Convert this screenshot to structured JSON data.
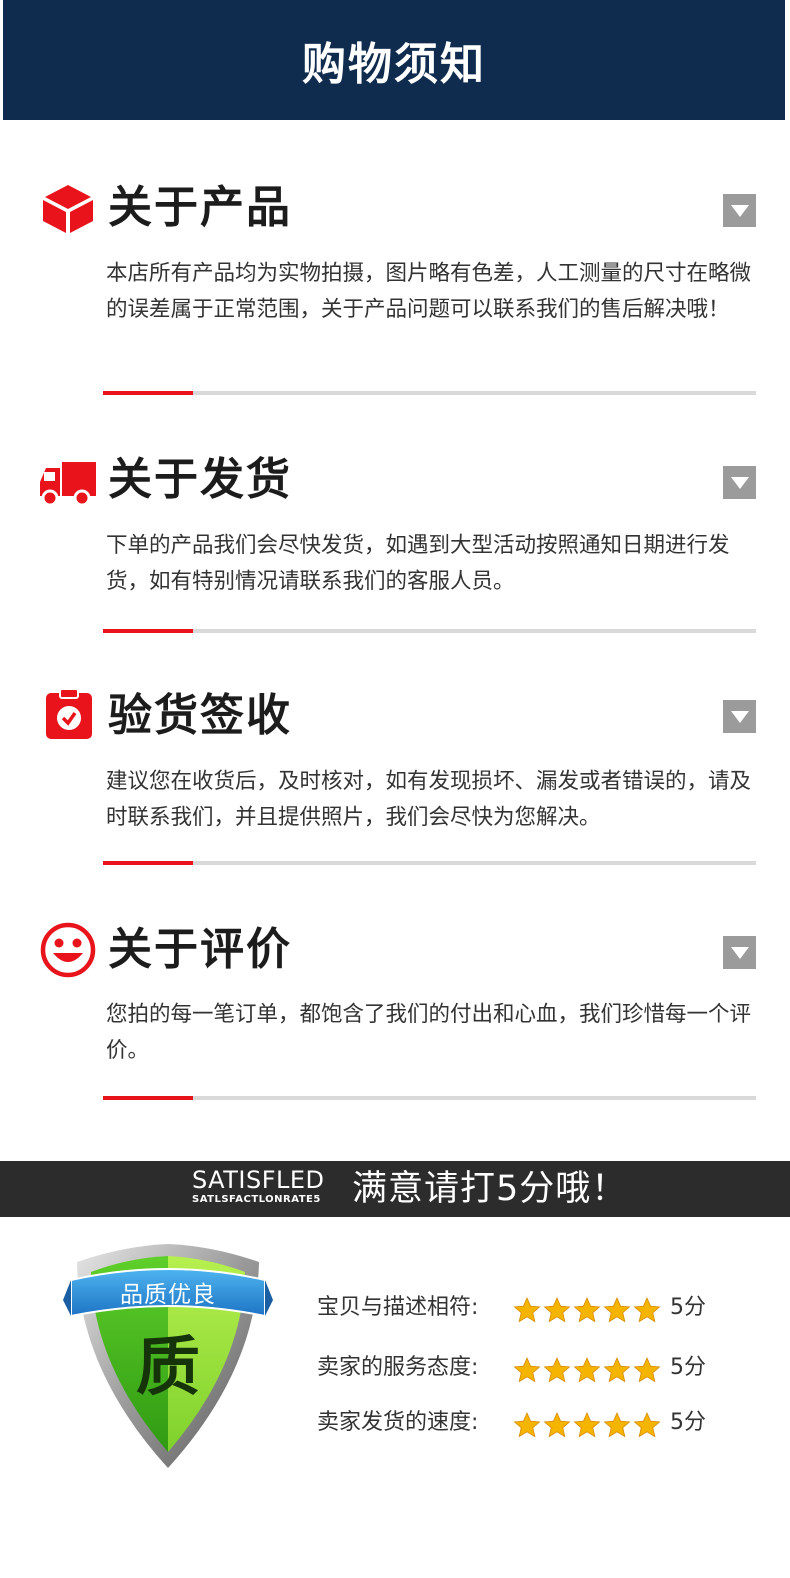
{
  "header": {
    "title": "购物须知"
  },
  "sections": [
    {
      "icon": "cube-icon",
      "title": "关于产品",
      "body": "本店所有产品均为实物拍摄，图片略有色差，人工测量的尺寸在略微的误差属于正常范围，关于产品问题可以联系我们的售后解决哦！"
    },
    {
      "icon": "truck-icon",
      "title": "关于发货",
      "body": "下单的产品我们会尽快发货，如遇到大型活动按照通知日期进行发货，如有特别情况请联系我们的客服人员。"
    },
    {
      "icon": "clipboard-check-icon",
      "title": "验货签收",
      "body": "建议您在收货后，及时核对，如有发现损坏、漏发或者错误的，请及时联系我们，并且提供照片，我们会尽快为您解决。"
    },
    {
      "icon": "smiley-icon",
      "title": "关于评价",
      "body": "您拍的每一笔订单，都饱含了我们的付出和心血，我们珍惜每一个评价。"
    }
  ],
  "banner": {
    "en_top": "SATISFLED",
    "en_bottom": "SATLSFACTLONRATE5",
    "cn": "满意请打5分哦！"
  },
  "badge": {
    "ribbon": "品质优良",
    "glyph": "质"
  },
  "ratings": [
    {
      "label": "宝贝与描述相符:",
      "stars": 5,
      "score": "5分"
    },
    {
      "label": "卖家的服务态度:",
      "stars": 5,
      "score": "5分"
    },
    {
      "label": "卖家发货的速度:",
      "stars": 5,
      "score": "5分"
    }
  ],
  "colors": {
    "header_bg": "#0f2c4f",
    "accent_red": "#e8131b",
    "banner_bg": "#2c2c2c",
    "toggle_gray": "#9b9b9b",
    "star_gold": "#f5b400"
  }
}
